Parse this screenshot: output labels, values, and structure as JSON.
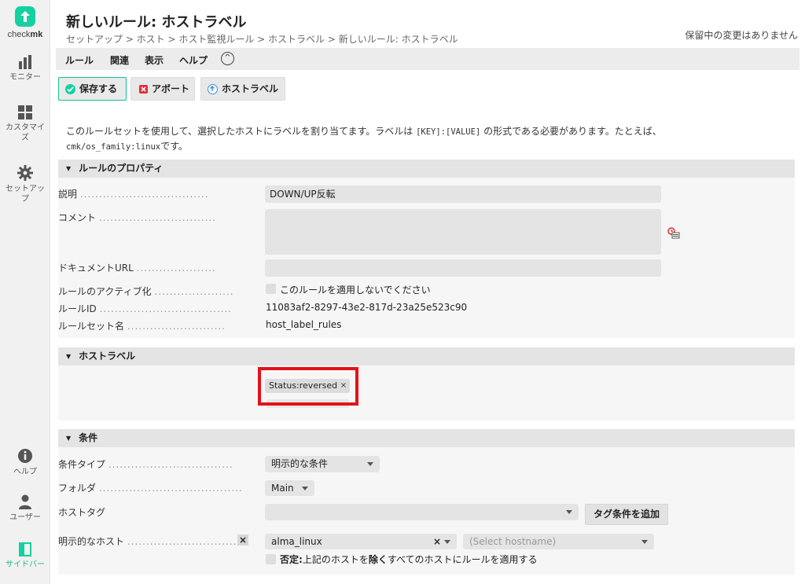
{
  "sidebar": {
    "logo_text_a": "check",
    "logo_text_b": "mk",
    "items": [
      {
        "label": "モニター"
      },
      {
        "label": "カスタマイズ"
      },
      {
        "label": "セットアップ"
      },
      {
        "label": "ヘルプ"
      },
      {
        "label": "ユーザー"
      },
      {
        "label": "サイドバー"
      }
    ]
  },
  "header": {
    "title": "新しいルール: ホストラベル",
    "breadcrumb": "セットアップ > ホスト > ホスト監視ルール > ホストラベル > 新しいルール: ホストラベル",
    "pending": "保留中の変更はありません"
  },
  "menu": {
    "items": [
      "ルール",
      "関連",
      "表示",
      "ヘルプ"
    ],
    "collapse_glyph": "^"
  },
  "toolbar": {
    "save_label": "保存する",
    "abort_label": "アボート",
    "hostlabel_label": "ホストラベル"
  },
  "intro": {
    "line1_a": "このルールセットを使用して、選択したホストにラベルを割り当てます。ラベルは",
    "line1_code": "[KEY]:[VALUE]",
    "line1_b": "の形式である必要があります。たとえば、",
    "line2_code": "cmk/os_family:linux",
    "line2_b": "です。"
  },
  "properties": {
    "header": "ルールのプロパティ",
    "description_label": "説明",
    "description_value": "DOWN/UP反転",
    "comment_label": "コメント",
    "comment_value": "",
    "docurl_label": "ドキュメントURL",
    "docurl_value": "",
    "activation_label": "ルールのアクティブ化",
    "activation_checkbox": "このルールを適用しないでください",
    "ruleid_label": "ルールID",
    "ruleid_value": "11083af2-8297-43e2-817d-23a25e523c90",
    "ruleset_label": "ルールセット名",
    "ruleset_value": "host_label_rules"
  },
  "host_labels": {
    "header": "ホストラベル",
    "tags": [
      "Status:reversed"
    ],
    "remove_glyph": "×"
  },
  "conditions": {
    "header": "条件",
    "type_label": "条件タイプ",
    "type_value": "明示的な条件",
    "folder_label": "フォルダ",
    "folder_value": "Main",
    "hosttag_label": "ホストタグ",
    "hosttag_value": "",
    "add_tag_button": "タグ条件を追加",
    "explicit_hosts_label": "明示的なホスト",
    "explicit_host_value": "alma_linux",
    "hostname_placeholder": "(Select hostname)",
    "negate_bold": "否定:",
    "negate_a": "上記のホストを",
    "negate_b": "除く",
    "negate_c": "すべてのホストにルールを適用する",
    "clear_glyph": "×"
  },
  "colors": {
    "brand": "#15d1a0",
    "highlight": "#e2121a"
  }
}
